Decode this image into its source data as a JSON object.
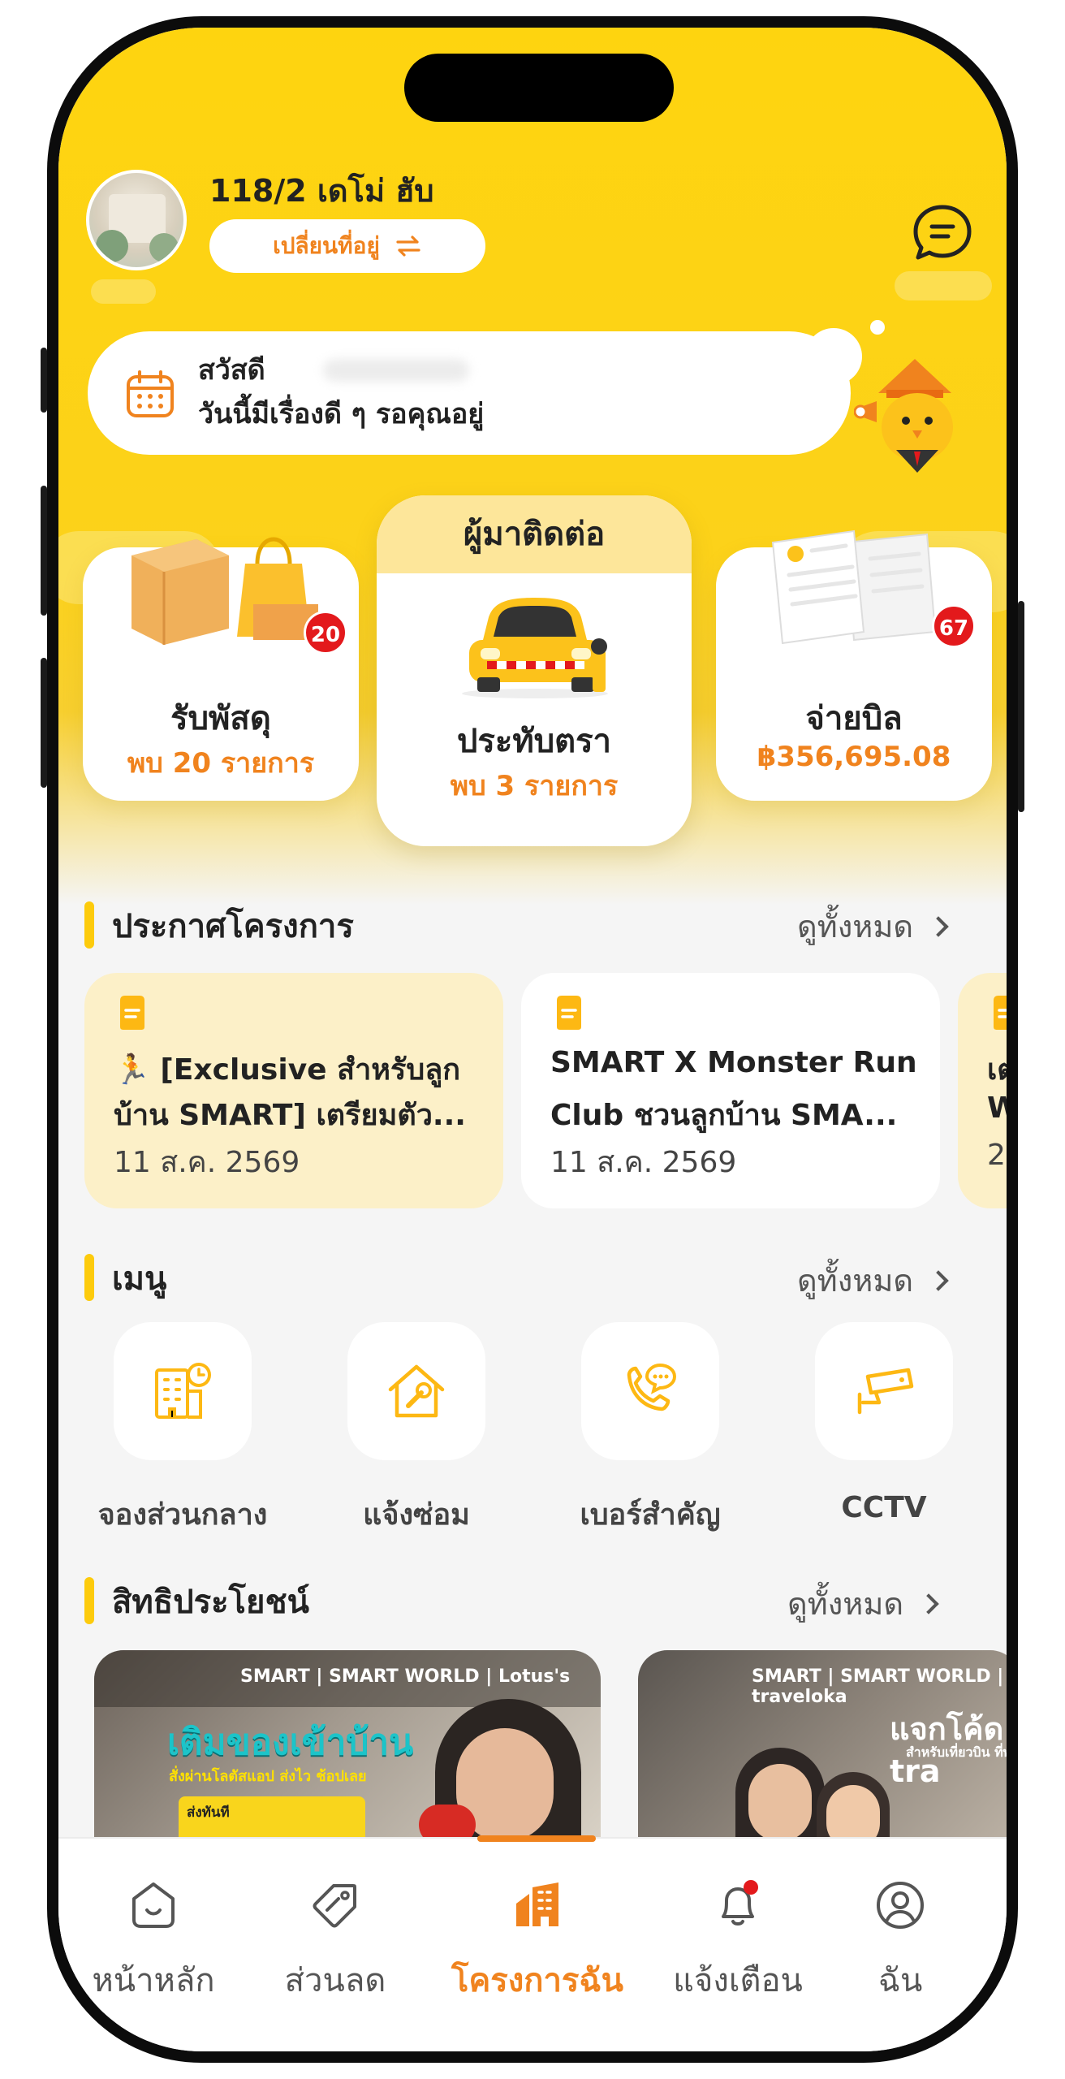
{
  "header": {
    "address": "118/2 เดโม่ ฮับ",
    "change_address_label": "เปลี่ยนที่อยู่"
  },
  "greeting": {
    "line1": "สวัสดี",
    "line2": "วันนี้มีเรื่องดี ๆ รอคุณอยู่"
  },
  "services": {
    "parcel": {
      "title": "รับพัสดุ",
      "sub": "พบ 20 รายการ",
      "badge": "20"
    },
    "visitor": {
      "header": "ผู้มาติดต่อ",
      "title": "ประทับตรา",
      "sub": "พบ 3 รายการ"
    },
    "bill": {
      "title": "จ่ายบิล",
      "sub": "฿356,695.08",
      "badge": "67"
    }
  },
  "announcements": {
    "title": "ประกาศโครงการ",
    "see_all": "ดูทั้งหมด",
    "items": [
      {
        "line1": "🏃 [Exclusive สำหรับลูก",
        "line2": "บ้าน SMART] เตรียมตัว...",
        "date": "11 ส.ค. 2569"
      },
      {
        "line1": "SMART X Monster Run",
        "line2": "Club ชวนลูกบ้าน SMA...",
        "date": "11 ส.ค. 2569"
      },
      {
        "line1": "เต",
        "line2": "W",
        "date": "2"
      }
    ]
  },
  "menu": {
    "title": "เมนู",
    "see_all": "ดูทั้งหมด",
    "items": [
      {
        "label": "จองส่วนกลาง",
        "icon": "building-clock-icon"
      },
      {
        "label": "แจ้งซ่อม",
        "icon": "house-wrench-icon"
      },
      {
        "label": "เบอร์สำคัญ",
        "icon": "phone-chat-icon"
      },
      {
        "label": "CCTV",
        "icon": "cctv-camera-icon"
      }
    ]
  },
  "benefits": {
    "title": "สิทธิประโยชน์",
    "see_all": "ดูทั้งหมด",
    "banners": [
      {
        "brand": "SMART | SMART WORLD | Lotus's",
        "headline": "เติมของเข้าบ้าน",
        "sub": "สั่งผ่านโลตัสแอป ส่งไว ช้อปเลย",
        "tag": "ส่งทันที"
      },
      {
        "brand": "SMART | SMART WORLD | traveloka",
        "headline": "แจกโค้ด tra",
        "sub": "สำหรับเที่ยวบิน ที่พั"
      }
    ]
  },
  "tabbar": {
    "items": [
      {
        "label": "หน้าหลัก",
        "icon": "home-icon"
      },
      {
        "label": "ส่วนลด",
        "icon": "tag-icon"
      },
      {
        "label": "โครงการฉัน",
        "icon": "buildings-icon"
      },
      {
        "label": "แจ้งเตือน",
        "icon": "bell-icon"
      },
      {
        "label": "ฉัน",
        "icon": "user-icon"
      }
    ],
    "active_index": 2
  },
  "colors": {
    "brand_yellow": "#fed40f",
    "accent_orange": "#f0831e",
    "badge_red": "#e3191c"
  }
}
